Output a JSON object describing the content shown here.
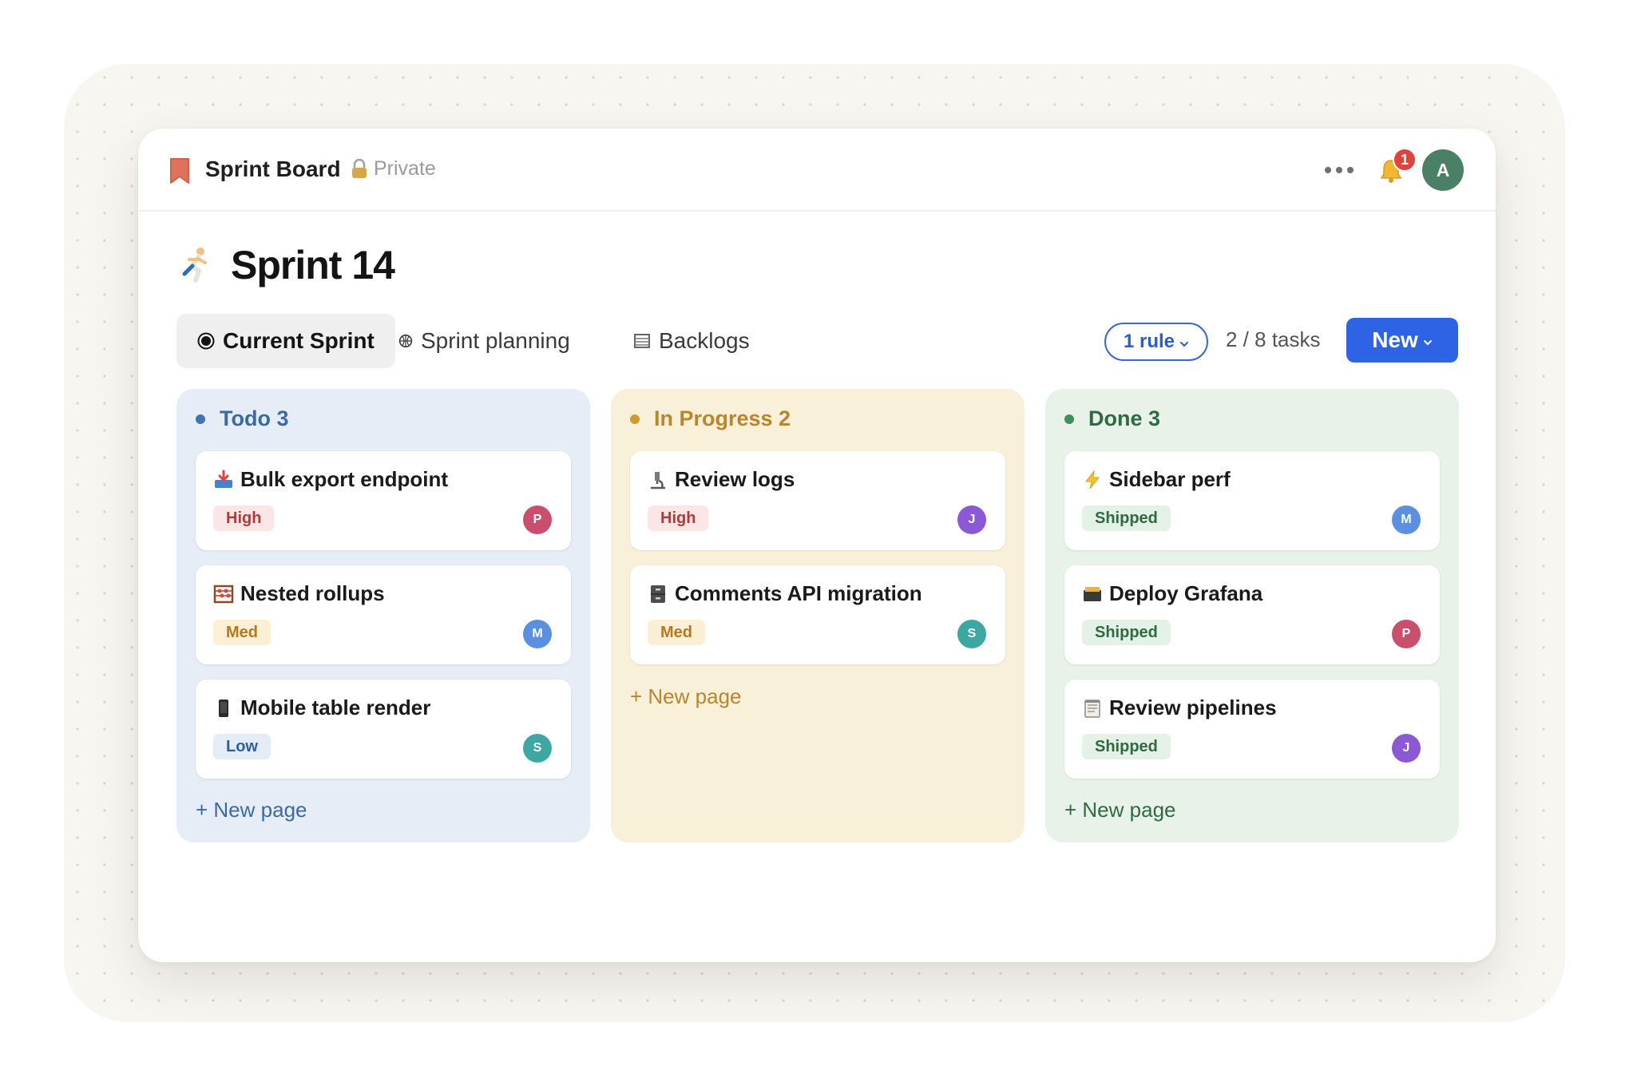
{
  "topbar": {
    "title": "Sprint Board",
    "privacy": "Private",
    "notification_count": "1",
    "user_initial": "A"
  },
  "page": {
    "title": "Sprint 14"
  },
  "tabs": [
    {
      "label": "Current Sprint",
      "active": true
    },
    {
      "label": "Sprint planning",
      "active": false
    },
    {
      "label": "Backlogs",
      "active": false
    }
  ],
  "toolbar": {
    "rule_label": "1 rule",
    "tasks_count": "2 / 8 tasks",
    "new_label": "New"
  },
  "colors": {
    "accent": "#2e63e6",
    "todo": "#3e73b8",
    "in_progress": "#d19a31",
    "done": "#3f9257"
  },
  "columns": [
    {
      "header": "Todo 3",
      "new_page": "+ New page",
      "cards": [
        {
          "icon": "inbox-tray-icon",
          "title": "Bulk export endpoint",
          "tag": "High",
          "assignee": "P"
        },
        {
          "icon": "abacus-icon",
          "title": "Nested rollups",
          "tag": "Med",
          "assignee": "M"
        },
        {
          "icon": "mobile-phone-icon",
          "title": "Mobile table render",
          "tag": "Low",
          "assignee": "S"
        }
      ]
    },
    {
      "header": "In Progress 2",
      "new_page": "+ New page",
      "cards": [
        {
          "icon": "microscope-icon",
          "title": "Review logs",
          "tag": "High",
          "assignee": "J"
        },
        {
          "icon": "file-cabinet-icon",
          "title": "Comments API migration",
          "tag": "Med",
          "assignee": "S"
        }
      ]
    },
    {
      "header": "Done 3",
      "new_page": "+ New page",
      "cards": [
        {
          "icon": "lightning-icon",
          "title": "Sidebar perf",
          "tag": "Shipped",
          "assignee": "M"
        },
        {
          "icon": "card-box-icon",
          "title": "Deploy Grafana",
          "tag": "Shipped",
          "assignee": "P"
        },
        {
          "icon": "notepad-icon",
          "title": "Review pipelines",
          "tag": "Shipped",
          "assignee": "J"
        }
      ]
    }
  ]
}
